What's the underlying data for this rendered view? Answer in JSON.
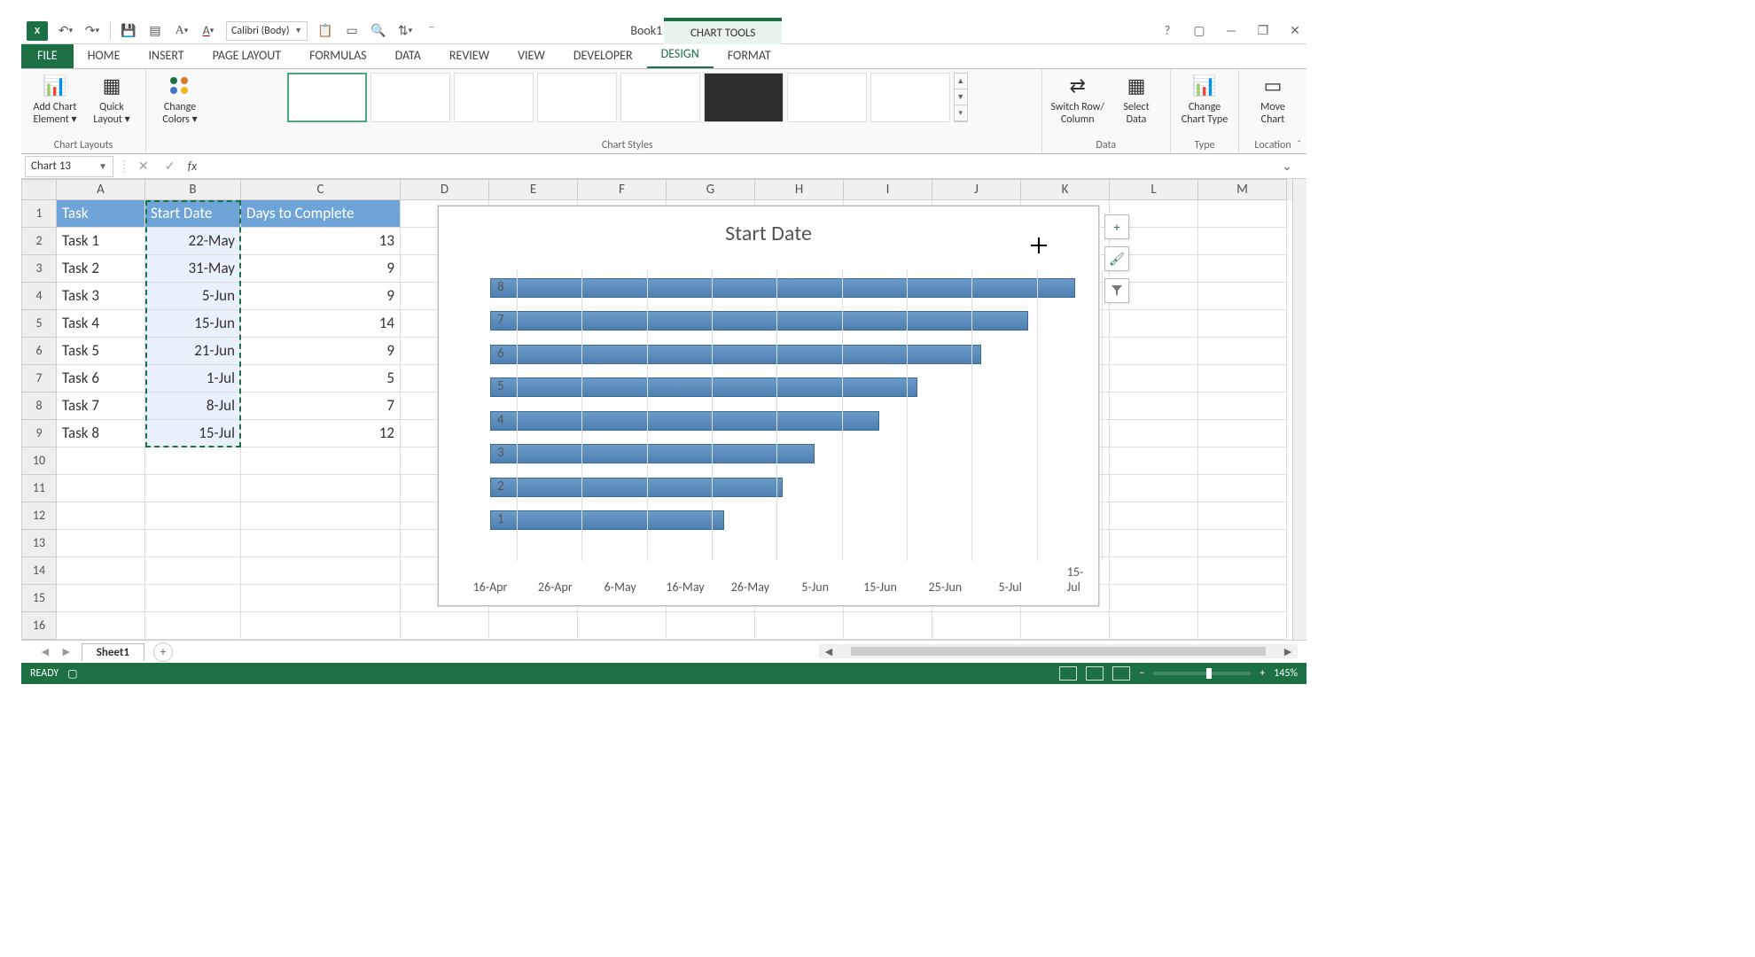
{
  "app": {
    "title": "Book1 - Excel",
    "context_tool": "CHART TOOLS"
  },
  "qat": {
    "excel_badge": "X",
    "font_name": "Calibri (Body)"
  },
  "tabs": {
    "file": "FILE",
    "items": [
      "HOME",
      "INSERT",
      "PAGE LAYOUT",
      "FORMULAS",
      "DATA",
      "REVIEW",
      "VIEW",
      "DEVELOPER",
      "DESIGN",
      "FORMAT"
    ],
    "active_index": 8
  },
  "ribbon": {
    "chart_layouts": {
      "label": "Chart Layouts",
      "add_element": "Add Chart\nElement ▾",
      "quick_layout": "Quick\nLayout ▾"
    },
    "change_colors": {
      "label": "Change\nColors ▾"
    },
    "chart_styles_label": "Chart Styles",
    "switch": "Switch Row/\nColumn",
    "select_data": "Select\nData",
    "data_label": "Data",
    "change_type": "Change\nChart Type",
    "type_label": "Type",
    "move_chart": "Move\nChart",
    "location_label": "Location"
  },
  "name_box": "Chart 13",
  "fx_label": "fx",
  "columns": [
    "A",
    "B",
    "C",
    "D",
    "E",
    "F",
    "G",
    "H",
    "I",
    "J",
    "K",
    "L",
    "M"
  ],
  "row_numbers": [
    "1",
    "2",
    "3",
    "4",
    "5",
    "6",
    "7",
    "8",
    "9",
    "10",
    "11",
    "12",
    "13",
    "14",
    "15",
    "16"
  ],
  "table": {
    "headers": {
      "task": "Task",
      "start": "Start Date",
      "days": "Days to Complete"
    },
    "rows": [
      {
        "task": "Task 1",
        "start": "22-May",
        "days": "13"
      },
      {
        "task": "Task 2",
        "start": "31-May",
        "days": "9"
      },
      {
        "task": "Task 3",
        "start": "5-Jun",
        "days": "9"
      },
      {
        "task": "Task 4",
        "start": "15-Jun",
        "days": "14"
      },
      {
        "task": "Task 5",
        "start": "21-Jun",
        "days": "9"
      },
      {
        "task": "Task 6",
        "start": "1-Jul",
        "days": "5"
      },
      {
        "task": "Task 7",
        "start": "8-Jul",
        "days": "7"
      },
      {
        "task": "Task 8",
        "start": "15-Jul",
        "days": "12"
      }
    ]
  },
  "chart_data": {
    "type": "bar",
    "title": "Start Date",
    "y_categories": [
      "1",
      "2",
      "3",
      "4",
      "5",
      "6",
      "7",
      "8"
    ],
    "x_ticks": [
      "16-Apr",
      "26-Apr",
      "6-May",
      "16-May",
      "26-May",
      "5-Jun",
      "15-Jun",
      "25-Jun",
      "5-Jul",
      "15-Jul"
    ],
    "series": [
      {
        "name": "Start Date",
        "values": [
          "22-May",
          "31-May",
          "5-Jun",
          "15-Jun",
          "21-Jun",
          "1-Jul",
          "8-Jul",
          "15-Jul"
        ],
        "values_frac": [
          0.4,
          0.5,
          0.555,
          0.665,
          0.73,
          0.84,
          0.92,
          1.0
        ]
      }
    ],
    "xlim": [
      "16-Apr",
      "15-Jul"
    ]
  },
  "chart_buttons": {
    "plus": "+",
    "brush": "🖌",
    "filter": "▾"
  },
  "sheet": {
    "name": "Sheet1",
    "new": "+"
  },
  "status": {
    "ready": "READY",
    "zoom": "145%",
    "minus": "−",
    "plus": "+"
  }
}
